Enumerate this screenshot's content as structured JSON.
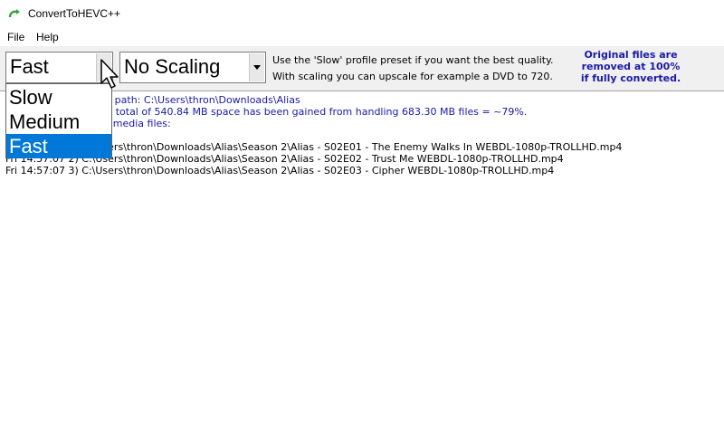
{
  "window": {
    "title": "ConvertToHEVC++"
  },
  "menu": {
    "file": "File",
    "help": "Help"
  },
  "toolbar": {
    "preset_value": "Fast",
    "scaling_value": "No Scaling",
    "hint_line1": "Use the 'Slow' profile preset if you want the best quality.",
    "hint_line2": "With scaling you can upscale for example a DVD to 720.",
    "notice_line1": "Original files are",
    "notice_line2": "removed at 100%",
    "notice_line3": "if fully converted."
  },
  "preset_dropdown": {
    "options": [
      "Slow",
      "Medium",
      "Fast"
    ],
    "selected": "Fast"
  },
  "log": {
    "lines": [
      "Fri 14:57:07  Selected path: C:\\Users\\thron\\Downloads\\Alias",
      "Fri 14:57:07  Result: A total of 540.84 MB space has been gained from handling 683.30 MB files = ~79%.",
      "Fri 14:57:07  Handled media files:",
      "",
      "Fri 14:57:07  1) C:\\Users\\thron\\Downloads\\Alias\\Season 2\\Alias - S02E01 - The Enemy Walks In WEBDL-1080p-TROLLHD.mp4",
      "Fri 14:57:07  2) C:\\Users\\thron\\Downloads\\Alias\\Season 2\\Alias - S02E02 - Trust Me WEBDL-1080p-TROLLHD.mp4",
      "Fri 14:57:07  3) C:\\Users\\thron\\Downloads\\Alias\\Season 2\\Alias - S02E03 - Cipher WEBDL-1080p-TROLLHD.mp4"
    ]
  },
  "colors": {
    "accent": "#0078d7",
    "notice_blue": "#1a1aa8",
    "toolbar_bg": "#f0f0f0"
  }
}
